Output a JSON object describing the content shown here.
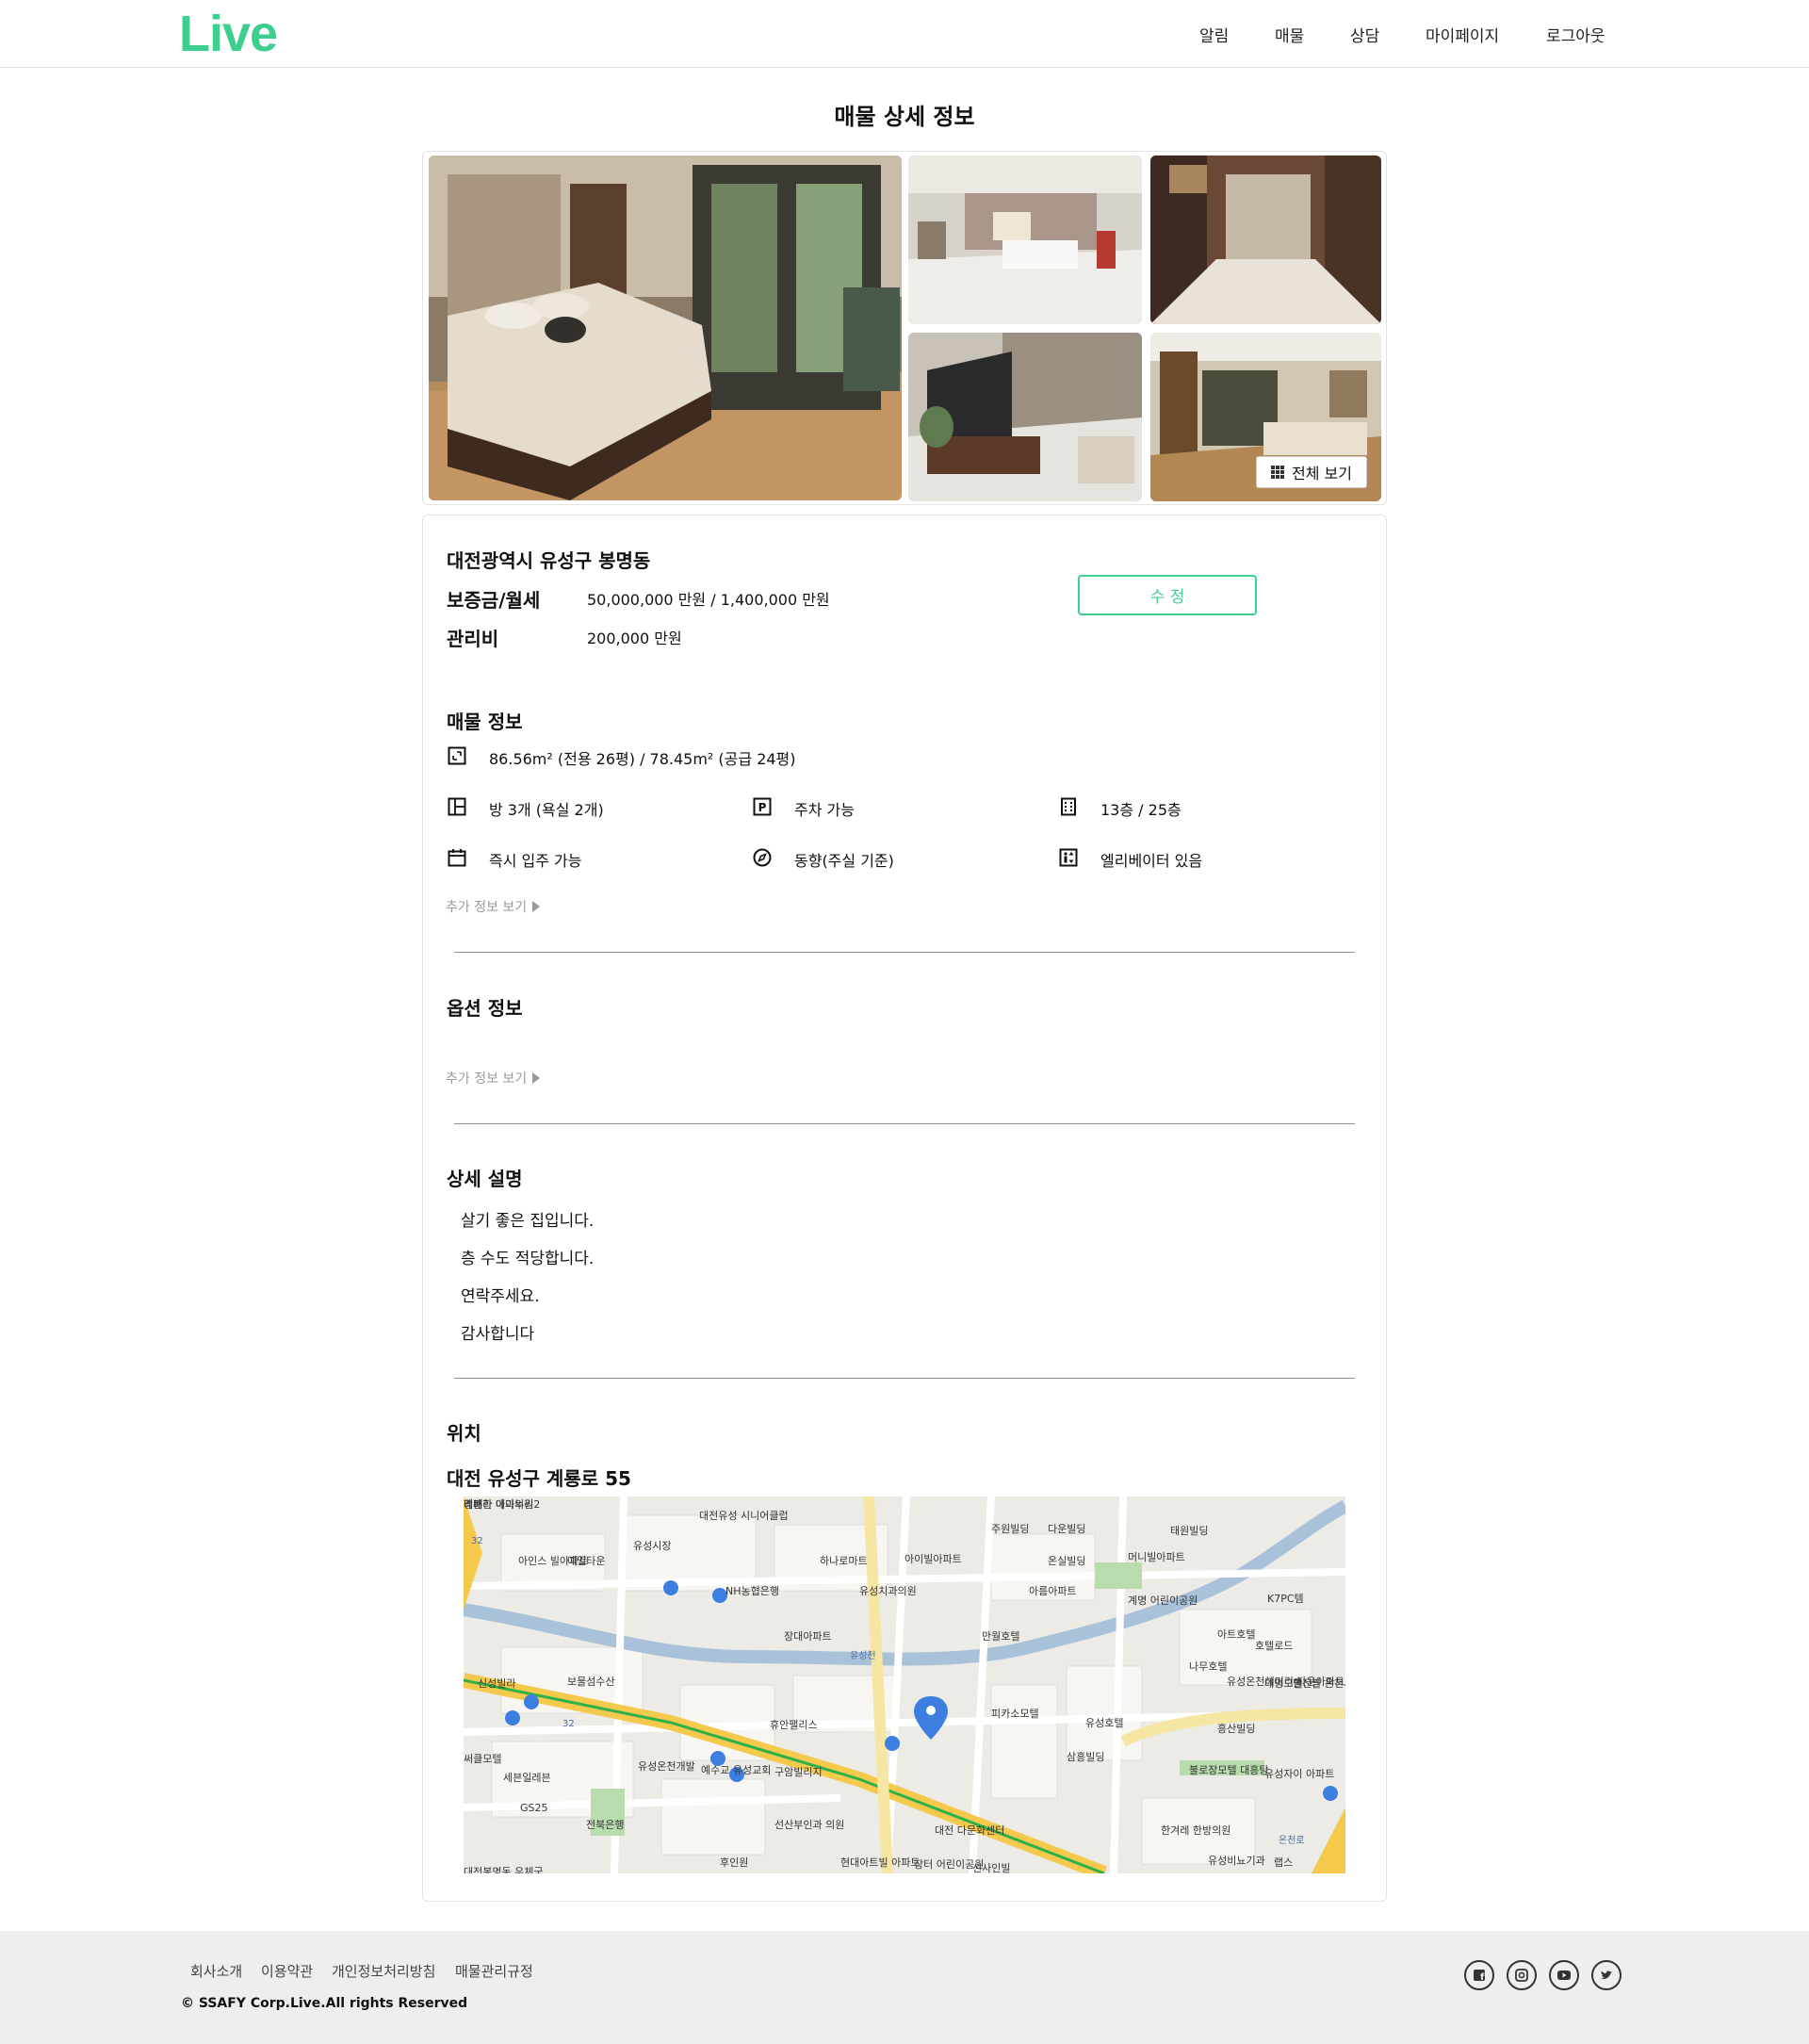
{
  "header": {
    "logo": "Live",
    "nav": [
      "알림",
      "매물",
      "상담",
      "마이페이지",
      "로그아웃"
    ]
  },
  "page_title": "매물 상세 정보",
  "gallery": {
    "view_all_label": "전체 보기"
  },
  "summary": {
    "address": "대전광역시 유성구 봉명동",
    "deposit_label": "보증금/월세",
    "deposit_value": "50,000,000 만원 / 1,400,000 만원",
    "fee_label": "관리비",
    "fee_value": "200,000 만원",
    "edit_button": "수 정"
  },
  "property_info": {
    "title": "매물 정보",
    "area": "86.56m² (전용 26평) / 78.45m² (공급 24평)",
    "rooms": "방 3개 (욕실 2개)",
    "parking": "주차 가능",
    "floor": "13층 / 25층",
    "move_in": "즉시 입주 가능",
    "direction": "동향(주실 기준)",
    "elevator": "엘리베이터 있음",
    "more": "추가 정보 보기"
  },
  "option_info": {
    "title": "옵션 정보",
    "more": "추가 정보 보기"
  },
  "description": {
    "title": "상세 설명",
    "lines": [
      "살기 좋은 집입니다.",
      "층 수도 적당합니다.",
      "연락주세요.",
      "감사합니다"
    ]
  },
  "location": {
    "title": "위치",
    "address": "대전 유성구 계룡로 55",
    "map_labels": [
      "대전유성 시니어클럽",
      "유성시장",
      "하나로마트",
      "아이빌아파트",
      "주원빌딩",
      "다운빌딩",
      "태원빌딩",
      "온실빌딩",
      "머니빌아파트",
      "아인스 빌아파트",
      "예일타운",
      "NH농협은행",
      "유성치과의원",
      "아름아파트",
      "계명 어린이공원",
      "K7PC템",
      "장대아파트",
      "만월호텔",
      "아트호텔",
      "호텔로드",
      "나무호텔",
      "대명모텔",
      "신성빌라",
      "보물섬수산",
      "유성온천헤미리 타운아파트",
      "한진블 온천사",
      "휴안팰리스",
      "피카소모텔",
      "유성호텔",
      "흥산빌딩",
      "삼흥빌딩",
      "불로장모텔 대흥탕",
      "유성자이 아파트",
      "써클모텔",
      "세븐일레븐",
      "유성온천개발",
      "예수교 유성교회",
      "구암빌리지",
      "선산부인과 의원",
      "대전 다문화센터",
      "한겨레 한방의원",
      "GS25",
      "전북은행",
      "후인원",
      "현대아트빌 아파트",
      "장터 어린이공원",
      "선사인빌",
      "유성비뇨기과",
      "랩스",
      "대전봉명동 우체국",
      "리베라 아이누리2",
      "명쾌한 내과의원",
      "레븐"
    ],
    "road_labels": [
      "32",
      "32",
      "유성천",
      "온천로"
    ]
  },
  "footer": {
    "links": [
      "회사소개",
      "이용약관",
      "개인정보처리방침",
      "매물관리규정"
    ],
    "copyright": "© SSAFY Corp.Live.All rights Reserved",
    "social": [
      "facebook-icon",
      "instagram-icon",
      "youtube-icon",
      "twitter-icon"
    ]
  },
  "colors": {
    "brand": "#3ecf8e",
    "divider": "#8d8d8d",
    "footer_bg": "#eeeeee"
  }
}
